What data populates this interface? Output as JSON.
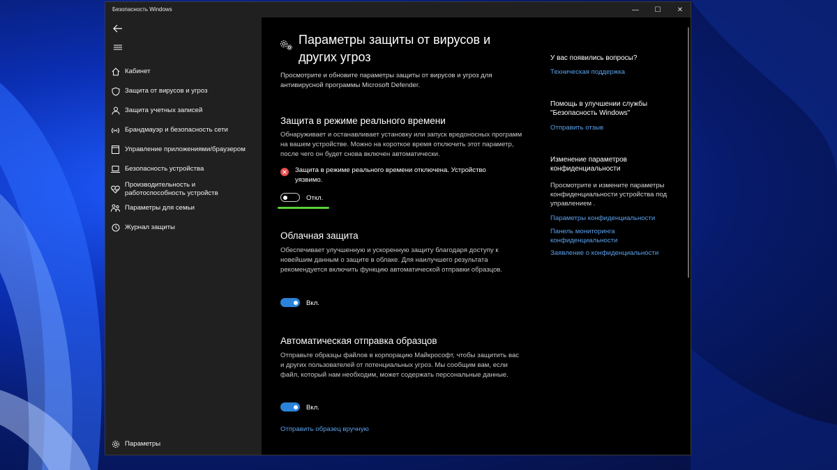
{
  "window": {
    "title": "Безопасность Windows",
    "controls": {
      "minimize": "—",
      "maximize": "☐",
      "close": "✕"
    }
  },
  "sidebar": {
    "items": [
      {
        "label": "Кабинет",
        "icon": "home-icon"
      },
      {
        "label": "Защита от вирусов и угроз",
        "icon": "shield-icon"
      },
      {
        "label": "Защита учетных записей",
        "icon": "person-icon"
      },
      {
        "label": "Брандмауэр и безопасность сети",
        "icon": "wifi-icon"
      },
      {
        "label": "Управление приложениями/браузером",
        "icon": "app-window-icon"
      },
      {
        "label": "Безопасность устройства",
        "icon": "laptop-icon"
      },
      {
        "label": "Производительность и работоспособность устройств",
        "icon": "heart-pulse-icon"
      },
      {
        "label": "Параметры для семьи",
        "icon": "family-icon"
      },
      {
        "label": "Журнал защиты",
        "icon": "history-icon"
      }
    ],
    "settings_label": "Параметры"
  },
  "main": {
    "title": "Параметры защиты от вирусов и других угроз",
    "intro": "Просмотрите и обновите параметры защиты от вирусов и угроз для антивирусной программы Microsoft Defender.",
    "realtime": {
      "heading": "Защита в режиме реального времени",
      "description": "Обнаруживает и останавливает установку или запуск вредоносных программ на вашем устройстве. Можно на короткое время отключить этот параметр, после чего он будет снова включен автоматически.",
      "warning": "Защита в режиме реального времени отключена. Устройство уязвимо.",
      "toggle_label": "Откл.",
      "toggle_on": false
    },
    "cloud": {
      "heading": "Облачная защита",
      "description": "Обеспечивает улучшенную и ускоренную защиту благодаря доступу к новейшим данным о защите в облаке. Для наилучшего результата рекомендуется включить функцию автоматической отправки образцов.",
      "toggle_label": "Вкл.",
      "toggle_on": true
    },
    "samples": {
      "heading": "Автоматическая отправка образцов",
      "description": "Отправьте образцы файлов в корпорацию Майкрософт, чтобы защитить вас и других пользователей от потенциальных угроз. Мы сообщим вам, если файл, который нам необходим, может содержать персональные данные.",
      "toggle_label": "Вкл.",
      "toggle_on": true,
      "manual_link": "Отправить образец вручную"
    }
  },
  "aside": {
    "questions_heading": "У вас появились вопросы?",
    "support_link": "Техническая поддержка",
    "improve_heading": "Помощь в улучшении службы \"Безопасность Windows\"",
    "feedback_link": "Отправить отзыв",
    "privacy_heading": "Изменение параметров конфиденциальности",
    "privacy_text": "Просмотрите и измените параметры конфиденциальности устройства под управлением .",
    "privacy_links": [
      "Параметры конфиденциальности",
      "Панель мониторинга конфиденциальности",
      "Заявление о конфиденциальности"
    ]
  },
  "colors": {
    "accent": "#2a83d8",
    "link": "#5aa0ea",
    "error": "#e84b4b",
    "highlight": "#5bd03a"
  }
}
